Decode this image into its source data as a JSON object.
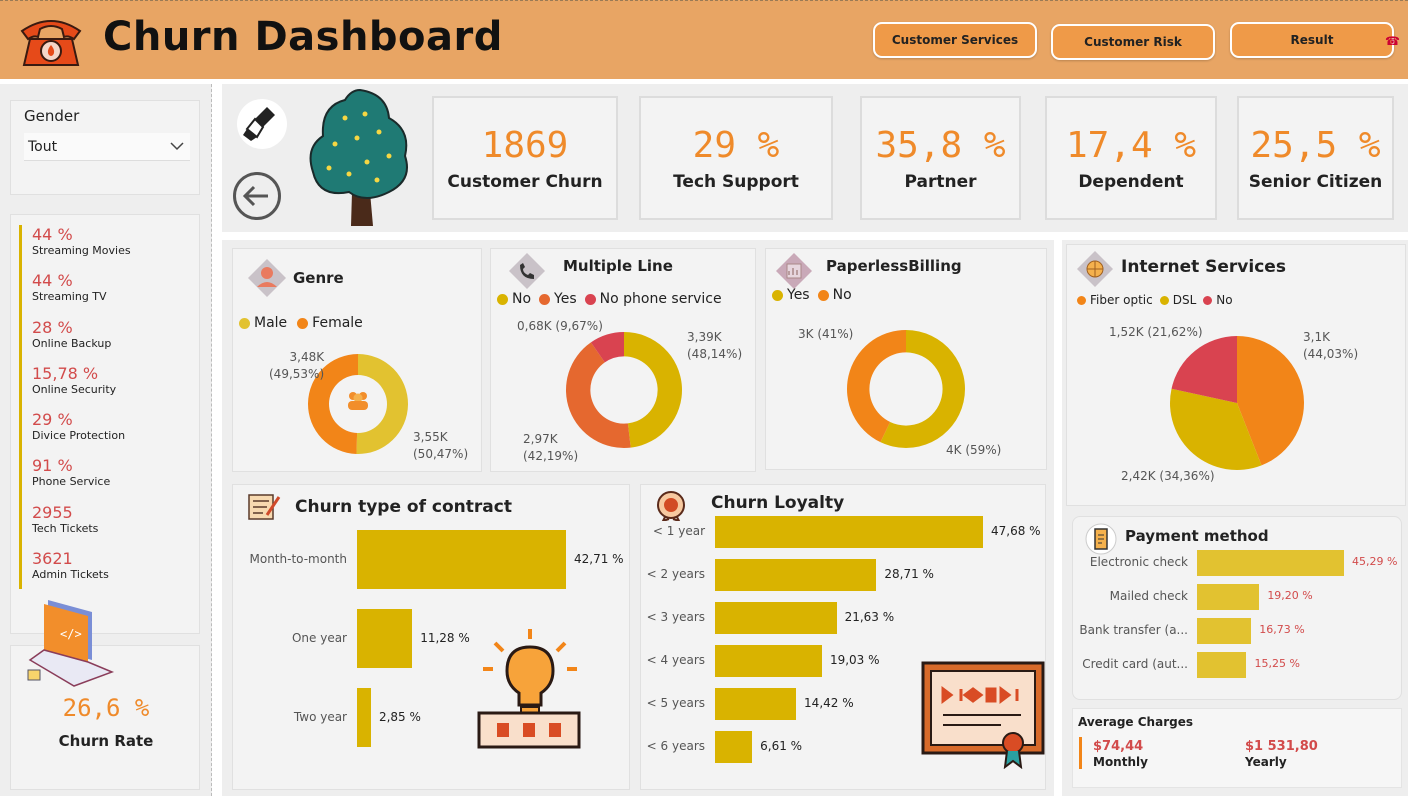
{
  "header": {
    "title": "Churn Dashboard",
    "buttons": [
      "Customer Services",
      "Customer Risk",
      "Result"
    ]
  },
  "filter": {
    "label": "Gender",
    "value": "Tout"
  },
  "side_stats": [
    {
      "value": "44 %",
      "label": "Streaming Movies"
    },
    {
      "value": "44 %",
      "label": "Streaming TV"
    },
    {
      "value": "28 %",
      "label": "Online Backup"
    },
    {
      "value": "15,78 %",
      "label": "Online Security"
    },
    {
      "value": "29 %",
      "label": "Divice Protection"
    },
    {
      "value": "91 %",
      "label": "Phone Service"
    },
    {
      "value": "2955",
      "label": "Tech Tickets"
    },
    {
      "value": "3621",
      "label": "Admin Tickets"
    }
  ],
  "churn_rate": {
    "value": "26,6 %",
    "label": "Churn Rate"
  },
  "kpis": [
    {
      "value": "1869",
      "label": "Customer Churn"
    },
    {
      "value": "29 %",
      "label": "Tech Support"
    },
    {
      "value": "35,8 %",
      "label": "Partner"
    },
    {
      "value": "17,4 %",
      "label": "Dependent"
    },
    {
      "value": "25,5 %",
      "label": "Senior Citizen"
    }
  ],
  "colors": {
    "accent": "#ef8a2a",
    "gold": "#d9b300",
    "orange": "#f28518",
    "red": "#d94350",
    "dark_orange": "#e5682f",
    "header": "#e8a564"
  },
  "genre": {
    "title": "Genre",
    "legend": [
      "Male",
      "Female"
    ],
    "labels": [
      "3,48K",
      "(49,53%)",
      "3,55K",
      "(50,47%)"
    ]
  },
  "multiple_line": {
    "title": "Multiple Line",
    "legend": [
      "No",
      "Yes",
      "No phone service"
    ],
    "labels": [
      "0,68K (9,67%)",
      "3,39K",
      "(48,14%)",
      "2,97K",
      "(42,19%)"
    ]
  },
  "paperless": {
    "title": "PaperlessBilling",
    "legend": [
      "Yes",
      "No"
    ],
    "labels": [
      "3K (41%)",
      "4K (59%)"
    ]
  },
  "internet": {
    "title": "Internet Services",
    "legend": [
      "Fiber optic",
      "DSL",
      "No"
    ],
    "labels": [
      "1,52K (21,62%)",
      "3,1K",
      "(44,03%)",
      "2,42K (34,36%)"
    ]
  },
  "contract": {
    "title": "Churn type of contract",
    "labels": [
      "42,71 %",
      "11,28 %",
      "2,85 %"
    ]
  },
  "loyalty": {
    "title": "Churn Loyalty",
    "labels": [
      "47,68 %",
      "28,71 %",
      "21,63 %",
      "19,03 %",
      "14,42 %",
      "6,61 %"
    ]
  },
  "payment": {
    "title": "Payment method",
    "labels": [
      "45,29 %",
      "19,20 %",
      "16,73 %",
      "15,25 %"
    ]
  },
  "charges": {
    "title": "Average Charges",
    "monthly_value": "$74,44",
    "monthly_label": "Monthly",
    "yearly_value": "$1 531,80",
    "yearly_label": "Yearly"
  },
  "chart_data": [
    {
      "type": "pie",
      "title": "Genre",
      "categories": [
        "Male",
        "Female"
      ],
      "values": [
        3.55,
        3.48
      ],
      "percent": [
        50.47,
        49.53
      ],
      "donut": true
    },
    {
      "type": "pie",
      "title": "Multiple Line",
      "categories": [
        "No",
        "Yes",
        "No phone service"
      ],
      "values": [
        3.39,
        2.97,
        0.68
      ],
      "percent": [
        48.14,
        42.19,
        9.67
      ],
      "donut": true
    },
    {
      "type": "pie",
      "title": "PaperlessBilling",
      "categories": [
        "Yes",
        "No"
      ],
      "values": [
        4,
        3
      ],
      "percent": [
        59,
        41
      ],
      "donut": true
    },
    {
      "type": "pie",
      "title": "Internet Services",
      "categories": [
        "Fiber optic",
        "DSL",
        "No"
      ],
      "values": [
        3.1,
        2.42,
        1.52
      ],
      "percent": [
        44.03,
        34.36,
        21.62
      ]
    },
    {
      "type": "bar",
      "title": "Churn type of contract",
      "categories": [
        "Month-to-month",
        "One year",
        "Two year"
      ],
      "values": [
        42.71,
        11.28,
        2.85
      ],
      "orientation": "horizontal"
    },
    {
      "type": "bar",
      "title": "Churn Loyalty",
      "categories": [
        "< 1 year",
        "< 2 years",
        "< 3 years",
        "< 4 years",
        "< 5 years",
        "< 6 years"
      ],
      "values": [
        47.68,
        28.71,
        21.63,
        19.03,
        14.42,
        6.61
      ],
      "orientation": "horizontal"
    },
    {
      "type": "bar",
      "title": "Payment method",
      "categories": [
        "Electronic check",
        "Mailed check",
        "Bank transfer (a...",
        "Credit card (aut..."
      ],
      "values": [
        45.29,
        19.2,
        16.73,
        15.25
      ],
      "orientation": "horizontal"
    }
  ]
}
